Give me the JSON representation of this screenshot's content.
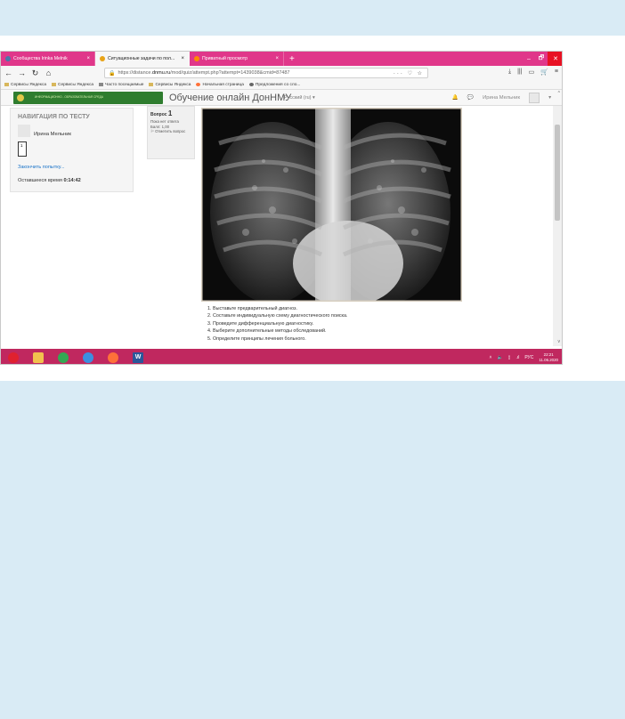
{
  "browser": {
    "tabs": [
      {
        "label": "Сообщества Irinka Melnik",
        "icon_color": "#4a76a8",
        "active": false
      },
      {
        "label": "Ситуационные задачи по пол...",
        "icon_color": "#e8a317",
        "active": true
      },
      {
        "label": "Приватный просмотр",
        "icon_color": "#ff8a00",
        "active": false
      }
    ],
    "new_tab": "+",
    "window_controls": [
      "–",
      "🗗",
      "✕"
    ],
    "url_prefix": "https://distance.",
    "url_host": "dnmu.ru",
    "url_path": "/mod/quiz/attempt.php?attempt=1439038&cmid=87487",
    "url_actions": "··· ♡ ☆",
    "bookmarks": [
      "Сервисы Яндекса",
      "Сервисы Яндекса",
      "Часто посещаемые",
      "Сервисы Яндекса",
      "Начальная страница",
      "Предложения со сло..."
    ]
  },
  "moodle": {
    "logo_text": "ИНФОРМАЦИОННО - ОБРАЗОВАТЕЛЬНАЯ СРЕДА",
    "site_title": "Обучение онлайн ДонНМУ",
    "language": "Русский (ru) ▾",
    "user_name": "Ирина Мельник"
  },
  "quiz_nav": {
    "title": "НАВИГАЦИЯ ПО ТЕСТУ",
    "user_name": "Ирина Мельник",
    "question_button": "1",
    "finish_link": "Закончить попытку...",
    "time_label": "Оставшееся время",
    "time_value": "0:14:42"
  },
  "question": {
    "label": "Вопрос",
    "number": "1",
    "status": "Пока нет ответа",
    "score": "Балл: 1,00",
    "flag": "Отметить вопрос"
  },
  "tasks": [
    "1. Выставьте предварительный диагноз.",
    "2. Составьте индивидуальную схему диагностического поиска.",
    "3. Проведите дифференциальную диагностику.",
    "4. Выберите дополнительные методы обследований.",
    "5. Определите принципы лечения больного."
  ],
  "taskbar": {
    "icons": [
      {
        "name": "opera",
        "color": "#e0212f"
      },
      {
        "name": "explorer",
        "color": "#f2c14e"
      },
      {
        "name": "chrome",
        "color": "#34a853"
      },
      {
        "name": "ie",
        "color": "#3c8fe0"
      },
      {
        "name": "firefox",
        "color": "#ff7139"
      }
    ],
    "word_label": "W",
    "language": "РУС",
    "time": "22:21",
    "date": "11.06.2020"
  }
}
